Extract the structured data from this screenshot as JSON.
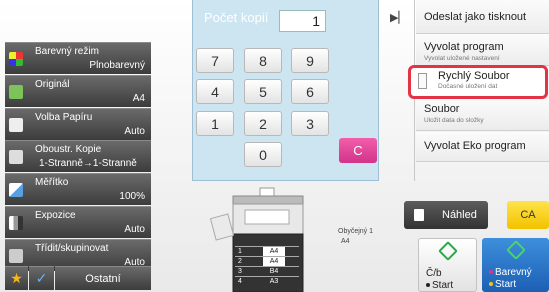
{
  "copies": {
    "label": "Počet kopií",
    "value": "1"
  },
  "keypad": {
    "keys": [
      "7",
      "8",
      "9",
      "4",
      "5",
      "6",
      "1",
      "2",
      "3",
      "0"
    ],
    "clear": "C"
  },
  "settings": [
    {
      "name": "Barevný režim",
      "value": "Plnobarevný",
      "icon": "color-mode-icon"
    },
    {
      "name": "Originál",
      "value": "A4",
      "icon": "original-icon"
    },
    {
      "name": "Volba Papíru",
      "value": "Auto",
      "icon": "paper-select-icon"
    },
    {
      "name": "Oboustr. Kopie",
      "value": "1-Stranně→1-Stranně",
      "icon": "duplex-icon"
    },
    {
      "name": "Měřítko",
      "value": "100%",
      "icon": "scale-icon"
    },
    {
      "name": "Expozice",
      "value": "Auto",
      "icon": "exposure-icon"
    },
    {
      "name": "Třídit/skupinovat",
      "value": "Auto",
      "icon": "sort-icon"
    }
  ],
  "bottom_left": {
    "other_label": "Ostatní"
  },
  "menu": {
    "send_as_print": "Odeslat jako tisknout",
    "recall_program": "Vyvolat program",
    "recall_program_sub": "Vyvolat uložené nastavení",
    "quick_file": "Rychlý Soubor",
    "quick_file_sub": "Dočasné uložení dat",
    "file": "Soubor",
    "file_sub": "Uložit data do složky",
    "eco_program": "Vyvolat Eko program"
  },
  "trays": [
    {
      "num": "1",
      "size": "A4"
    },
    {
      "num": "2",
      "size": "A4"
    },
    {
      "num": "3",
      "size": "B4"
    },
    {
      "num": "4",
      "size": "A3"
    }
  ],
  "paper": {
    "type": "Obyčejný 1",
    "size": "A4"
  },
  "buttons": {
    "preview": "Náhled",
    "ca": "CA",
    "bw_start_1": "Č/b",
    "bw_start_2": "Start",
    "color_start_1": "Barevný",
    "color_start_2": "Start"
  },
  "colors": {
    "keypad_bg": "#cde4f1",
    "clear_key": "#e0489a",
    "highlight": "#e33344",
    "ca_button": "#f5c800",
    "color_start": "#2a7acc",
    "start_diamond": "#2aa84a"
  }
}
